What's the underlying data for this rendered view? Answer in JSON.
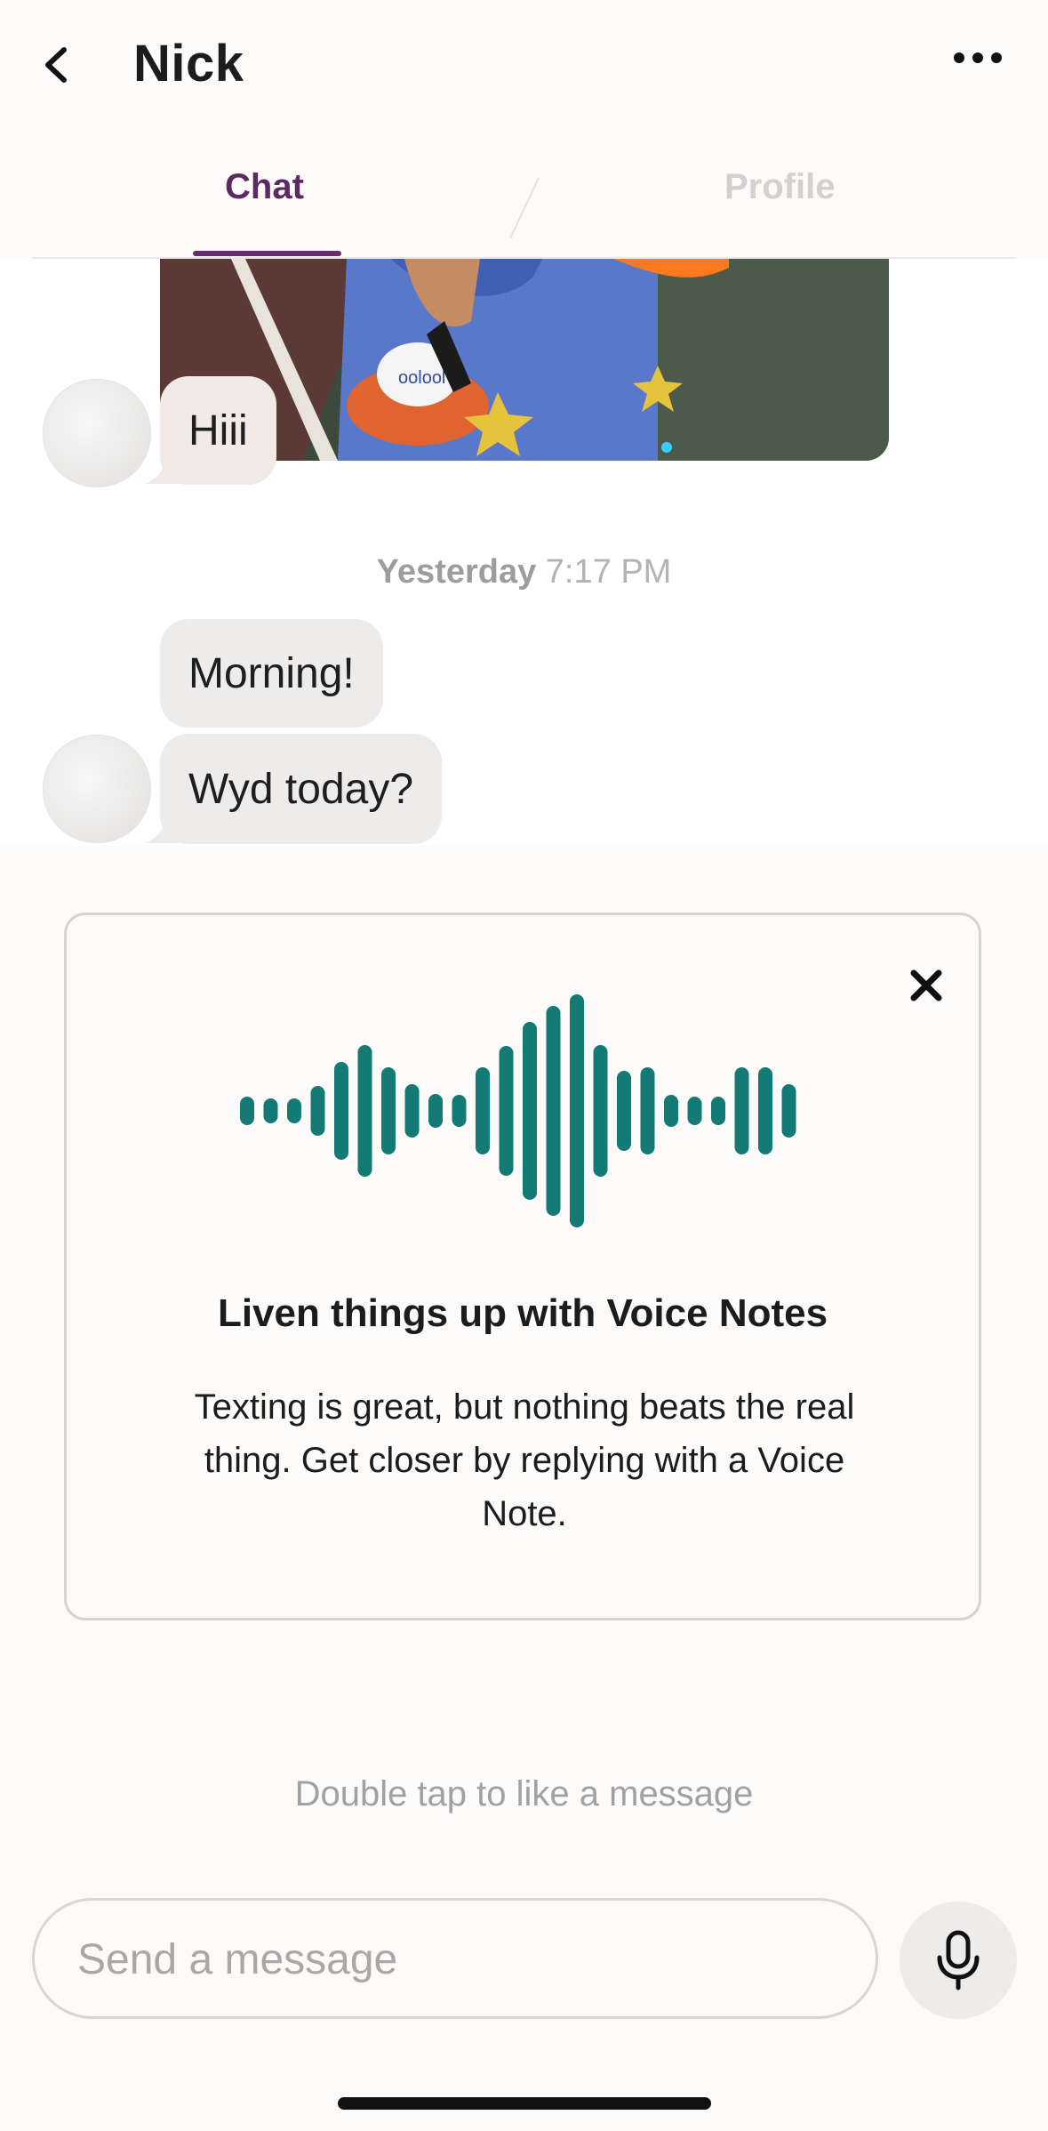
{
  "header": {
    "contact_name": "Nick"
  },
  "tabs": [
    {
      "label": "Chat",
      "active": true
    },
    {
      "label": "Profile",
      "active": false
    }
  ],
  "messages": {
    "first_group": {
      "text": "Hiii"
    },
    "timestamp": {
      "day": "Yesterday",
      "time": "7:17 PM"
    },
    "second_group": [
      {
        "text": "Morning!"
      },
      {
        "text": "Wyd today?"
      }
    ]
  },
  "voice_note_card": {
    "title": "Liven things up with Voice Notes",
    "body": "Texting is great, but nothing beats the real thing. Get closer by replying with a Voice Note.",
    "wave_color": "#147a75"
  },
  "hint": "Double tap to like a message",
  "composer": {
    "placeholder": "Send a message"
  },
  "colors": {
    "accent": "#5c2a63",
    "background": "#fcfbfa"
  }
}
